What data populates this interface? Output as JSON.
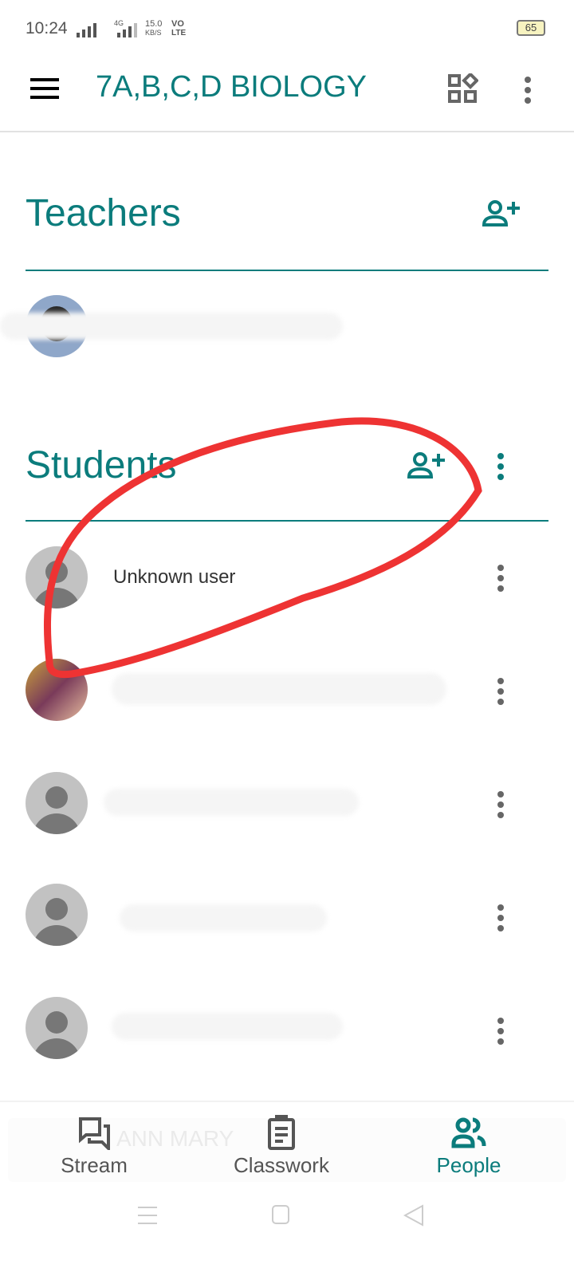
{
  "status_bar": {
    "time": "10:24",
    "network_speed": "15.0",
    "network_unit": "KB/S",
    "network_type": "4G",
    "volte": "VO",
    "lte": "LTE",
    "battery": "65"
  },
  "app_bar": {
    "title": "7A,B,C,D BIOLOGY",
    "icons": [
      "menu-icon",
      "class-apps-icon",
      "more-vert-icon"
    ]
  },
  "teachers": {
    "heading": "Teachers"
  },
  "students": {
    "heading": "Students",
    "items": [
      {
        "name": "Unknown user"
      }
    ],
    "faded_name": "ANN MARY"
  },
  "bottom_nav": {
    "tabs": [
      {
        "label": "Stream"
      },
      {
        "label": "Classwork"
      },
      {
        "label": "People",
        "active": true
      }
    ]
  },
  "colors": {
    "accent": "#0b7c7c",
    "annotation": "#ee3333"
  }
}
